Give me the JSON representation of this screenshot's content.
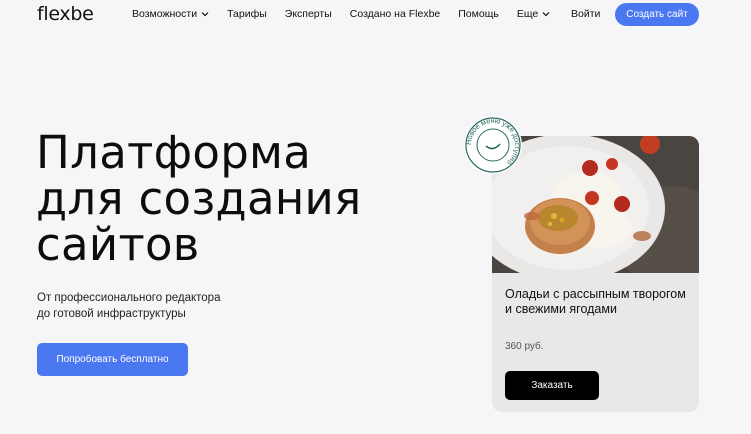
{
  "header": {
    "logo": "flexbe",
    "nav": [
      {
        "label": "Возможности",
        "dropdown": true
      },
      {
        "label": "Тарифы",
        "dropdown": false
      },
      {
        "label": "Эксперты",
        "dropdown": false
      },
      {
        "label": "Создано на Flexbe",
        "dropdown": false
      },
      {
        "label": "Помощь",
        "dropdown": false
      },
      {
        "label": "Еще",
        "dropdown": true
      }
    ],
    "login": "Войти",
    "create_site": "Создать сайт"
  },
  "hero": {
    "title_lines": [
      "Платформа",
      "для создания",
      "сайтов"
    ],
    "subtitle_lines": [
      "От профессионального редактора",
      "до готовой инфраструктуры"
    ],
    "cta": "Попробовать бесплатно"
  },
  "card": {
    "badge_text": "Новое меню уже доступно",
    "dish_name": "Оладьи с рассыпным творогом и свежими ягодами",
    "price": "360 руб.",
    "order_button": "Заказать"
  },
  "colors": {
    "accent": "#4a78f0",
    "background": "#f6f6f8",
    "card_bg": "#e8e8ea",
    "badge": "#2a6a60"
  }
}
